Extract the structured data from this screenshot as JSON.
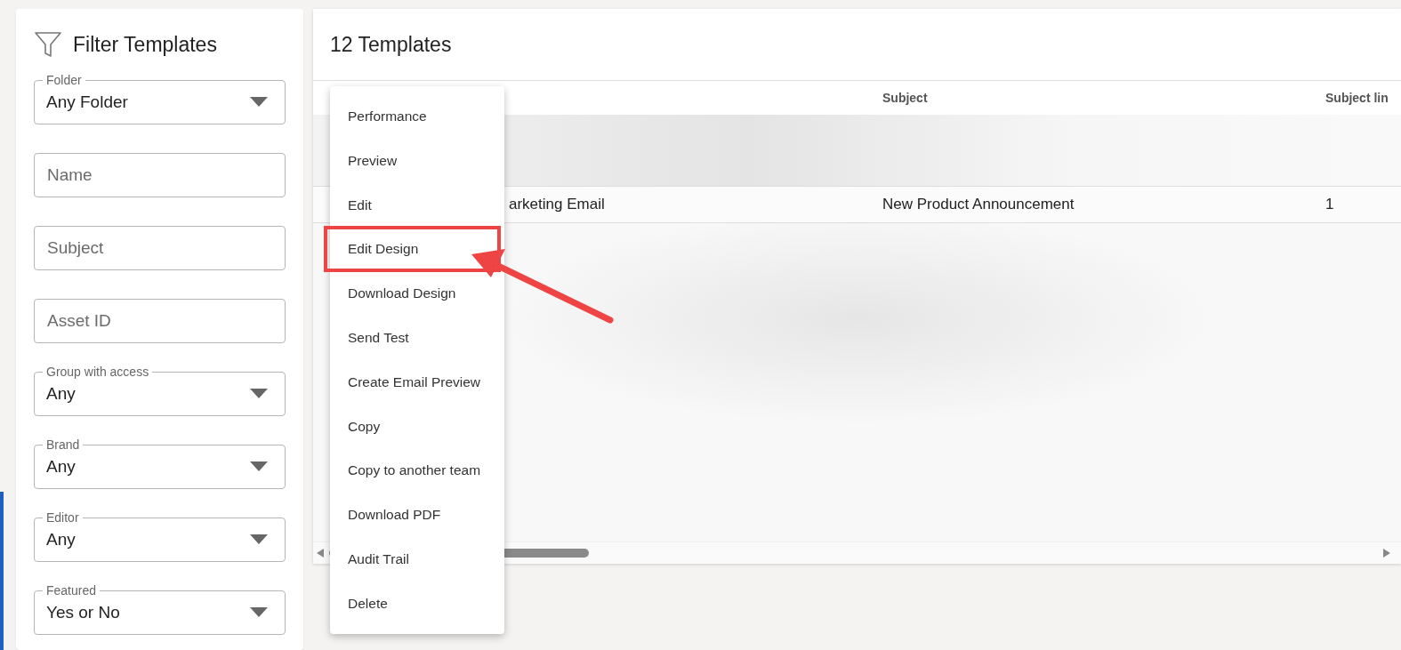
{
  "filter_panel": {
    "title": "Filter Templates",
    "fields": [
      {
        "kind": "select",
        "label": "Folder",
        "value": "Any Folder"
      },
      {
        "kind": "text",
        "placeholder": "Name"
      },
      {
        "kind": "text",
        "placeholder": "Subject"
      },
      {
        "kind": "text",
        "placeholder": "Asset ID"
      },
      {
        "kind": "select",
        "label": "Group with access",
        "value": "Any"
      },
      {
        "kind": "select",
        "label": "Brand",
        "value": "Any"
      },
      {
        "kind": "select",
        "label": "Editor",
        "value": "Any"
      },
      {
        "kind": "select",
        "label": "Featured",
        "value": "Yes or No"
      }
    ]
  },
  "templates": {
    "title": "12 Templates",
    "table": {
      "columns": [
        "Subject",
        "Subject lin"
      ],
      "rows": [
        {
          "kind": "blurred"
        },
        {
          "kind": "row",
          "cells": [
            "arketing Email",
            "New Product Announcement",
            "1"
          ]
        },
        {
          "kind": "blurred"
        }
      ]
    }
  },
  "context_menu": {
    "items": [
      {
        "label": "Performance",
        "highlighted": false
      },
      {
        "label": "Preview",
        "highlighted": false
      },
      {
        "label": "Edit",
        "highlighted": false
      },
      {
        "label": "Edit Design",
        "highlighted": true
      },
      {
        "label": "Download Design",
        "highlighted": false
      },
      {
        "label": "Send Test",
        "highlighted": false
      },
      {
        "label": "Create Email Preview",
        "highlighted": false
      },
      {
        "label": "Copy",
        "highlighted": false
      },
      {
        "label": "Copy to another team",
        "highlighted": false
      },
      {
        "label": "Download PDF",
        "highlighted": false
      },
      {
        "label": "Audit Trail",
        "highlighted": false
      },
      {
        "label": "Delete",
        "highlighted": false
      }
    ]
  }
}
